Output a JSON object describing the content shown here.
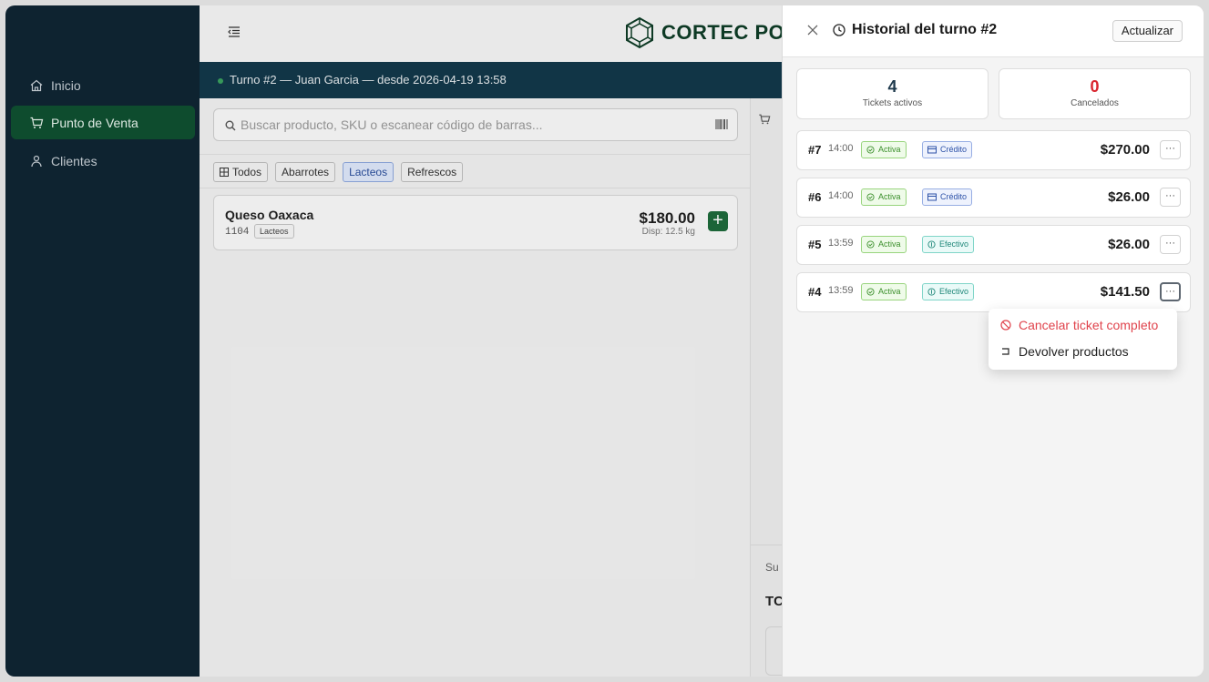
{
  "sidebar": {
    "items": [
      {
        "label": "Inicio",
        "icon": "home-icon"
      },
      {
        "label": "Punto de Venta",
        "icon": "cart-icon",
        "active": true
      },
      {
        "label": "Clientes",
        "icon": "users-icon"
      }
    ]
  },
  "header": {
    "brand": "CORTEC POS"
  },
  "shift": {
    "text": "Turno #2 — Juan Garcia — desde 2026-04-19 13:58"
  },
  "search": {
    "placeholder": "Buscar producto, SKU o escanear código de barras..."
  },
  "filters": [
    {
      "label": "Todos"
    },
    {
      "label": "Abarrotes"
    },
    {
      "label": "Lacteos",
      "selected": true
    },
    {
      "label": "Refrescos"
    }
  ],
  "products": [
    {
      "name": "Queso Oaxaca",
      "sku": "1104",
      "tag": "Lacteos",
      "price": "$180.00",
      "stock": "Disp: 12.5 kg"
    }
  ],
  "cart": {
    "subtotal_label": "Su",
    "total_label": "TC"
  },
  "drawer": {
    "title": "Historial del turno #2",
    "refresh_label": "Actualizar",
    "stats": [
      {
        "value": "4",
        "label": "Tickets activos",
        "color": "#1f3a4d"
      },
      {
        "value": "0",
        "label": "Cancelados",
        "color": "#d9262f"
      }
    ],
    "tickets": [
      {
        "no": "#7",
        "time": "14:00",
        "status": "Activa",
        "method": "Crédito",
        "method_type": "credit",
        "amount": "$270.00",
        "more": "···"
      },
      {
        "no": "#6",
        "time": "14:00",
        "status": "Activa",
        "method": "Crédito",
        "method_type": "credit",
        "amount": "$26.00",
        "more": "···"
      },
      {
        "no": "#5",
        "time": "13:59",
        "status": "Activa",
        "method": "Efectivo",
        "method_type": "cash",
        "amount": "$26.00",
        "more": "···"
      },
      {
        "no": "#4",
        "time": "13:59",
        "status": "Activa",
        "method": "Efectivo",
        "method_type": "cash",
        "amount": "$141.50",
        "more": "···"
      }
    ],
    "menu": {
      "cancel_label": "Cancelar ticket completo",
      "return_label": "Devolver productos"
    }
  }
}
